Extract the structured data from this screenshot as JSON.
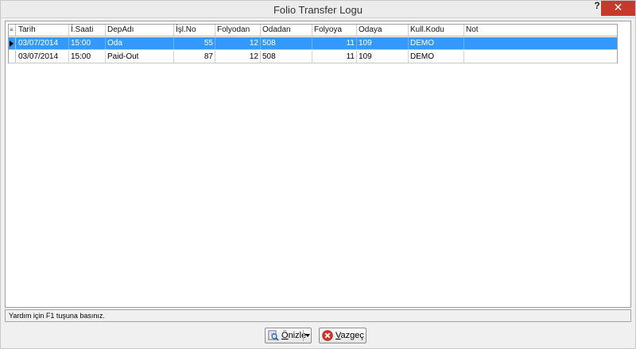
{
  "window": {
    "title": "Folio Transfer Logu",
    "help_label": "?",
    "close_label": "✕"
  },
  "grid": {
    "menu_glyph": "≡",
    "columns": [
      "Tarih",
      "İ.Saati",
      "DepAdı",
      "İşl.No",
      "Folyodan",
      "Odadan",
      "Folyoya",
      "Odaya",
      "Kull.Kodu",
      "Not"
    ],
    "rows": [
      {
        "tarih": "03/07/2014",
        "saat": "15:00",
        "depadi": "Oda",
        "islno": "55",
        "folyodan": "12",
        "odadan": "508",
        "folyoya": "11",
        "odaya": "109",
        "kullkodu": "DEMO",
        "not": ""
      },
      {
        "tarih": "03/07/2014",
        "saat": "15:00",
        "depadi": "Paid-Out",
        "islno": "87",
        "folyodan": "12",
        "odadan": "508",
        "folyoya": "11",
        "odaya": "109",
        "kullkodu": "DEMO",
        "not": ""
      }
    ]
  },
  "status": {
    "text": "Yardım için F1 tuşuna basınız."
  },
  "buttons": {
    "preview_first": "Ö",
    "preview_rest": "nizle",
    "cancel_first": "V",
    "cancel_rest": "azgeç"
  },
  "colors": {
    "selection": "#3399ff",
    "close": "#c7392b"
  }
}
